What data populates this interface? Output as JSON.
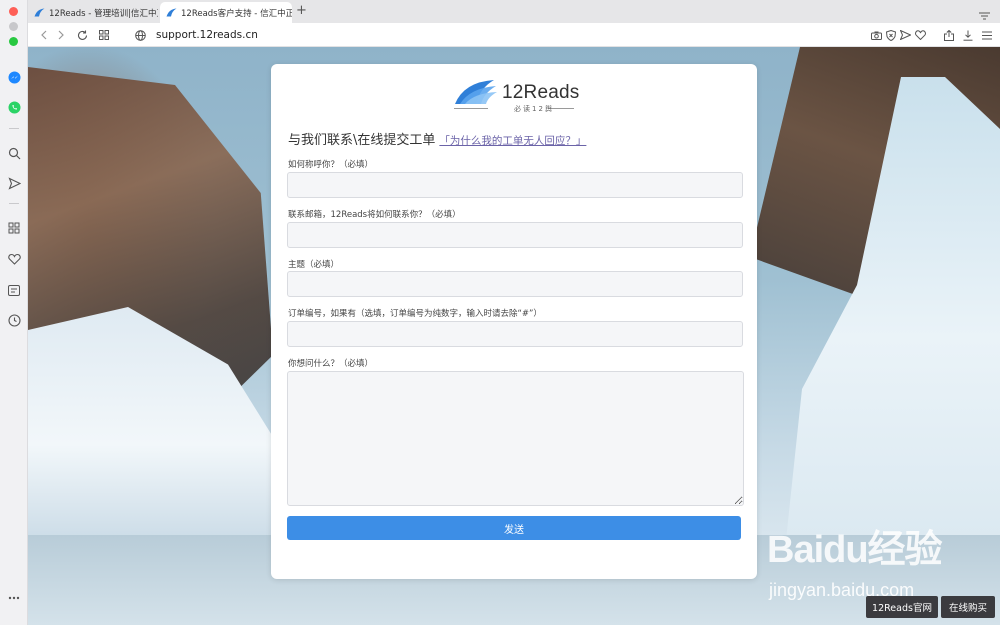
{
  "browser": {
    "tabs": [
      {
        "label": "12Reads - 管理培训|信汇中正"
      },
      {
        "label": "12Reads客户支持 - 信汇中正"
      }
    ],
    "url": {
      "host": "support.12reads.cn"
    }
  },
  "colors": {
    "accent": "#3d8ee6",
    "link": "#6b63a8",
    "logo_blue": "#2f7fd8"
  },
  "brand": {
    "name": "12Reads",
    "tagline": "必读12舆"
  },
  "form": {
    "title": "与我们联系\\在线提交工单",
    "help_link": "「为什么我的工单无人回应？」",
    "fields": [
      {
        "label": "如何称呼你？（必填）",
        "value": ""
      },
      {
        "label": "联系邮箱，12Reads将如何联系你？（必填）",
        "value": ""
      },
      {
        "label": "主题（必填）",
        "value": ""
      },
      {
        "label": "订单编号，如果有（选填，订单编号为纯数字，输入时请去除“#”）",
        "value": ""
      },
      {
        "label": "你想问什么？（必填）",
        "value": ""
      }
    ],
    "submit_label": "发送"
  },
  "watermark": {
    "big": "Baidu经验",
    "small": "jingyan.baidu.com"
  },
  "floating": {
    "official_site": "12Reads官网",
    "buy_online": "在线购买"
  }
}
